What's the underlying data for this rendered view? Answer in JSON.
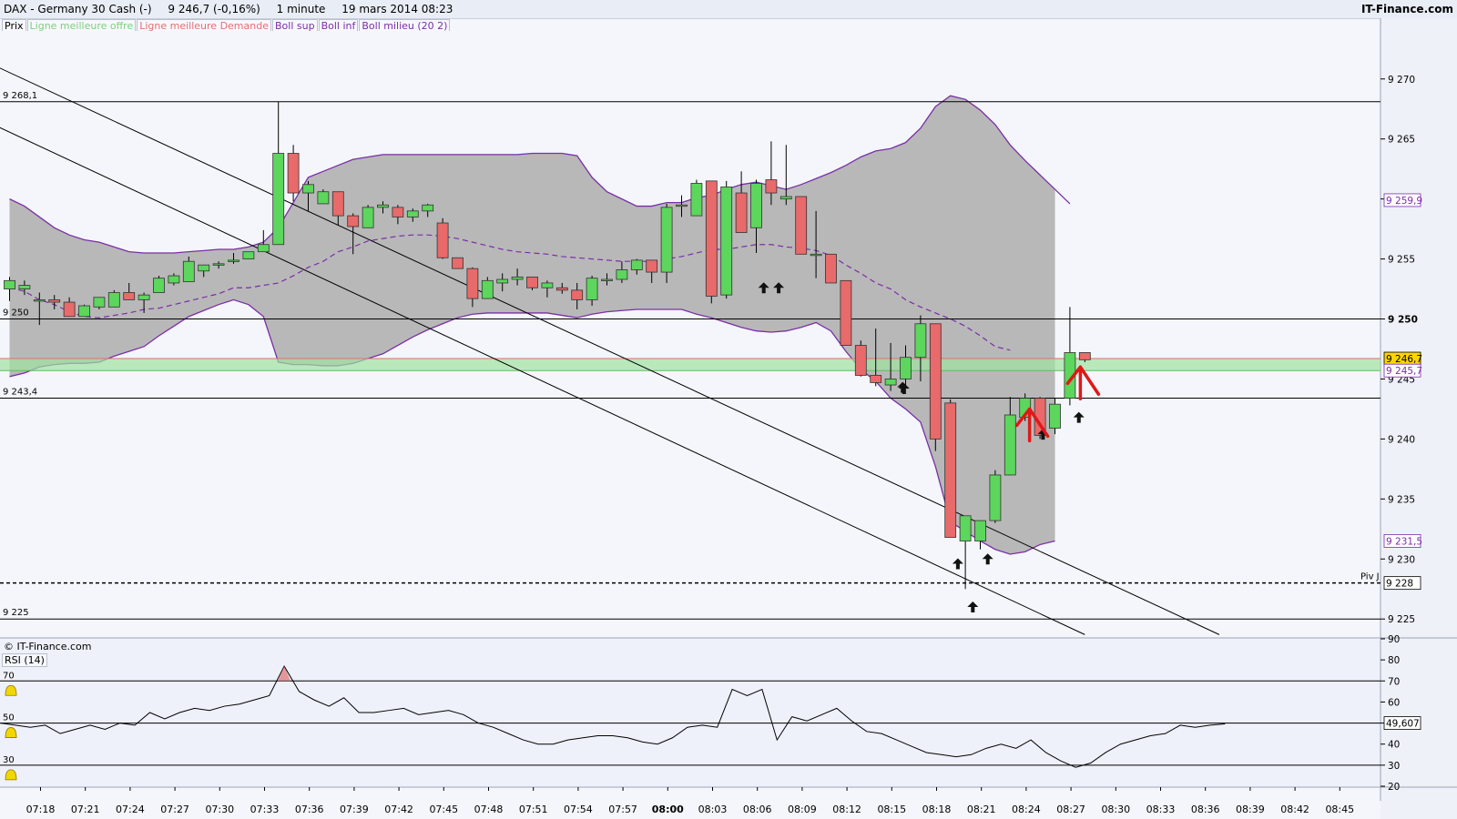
{
  "header": {
    "instrument": "DAX - Germany 30 Cash (-)",
    "last": "9 246,7 (-0,16%)",
    "timeframe": "1 minute",
    "datetime": "19 mars 2014 08:23",
    "site": "IT-Finance.com"
  },
  "legend": [
    {
      "label": "Prix",
      "color": "#000000"
    },
    {
      "label": "Ligne meilleure offre",
      "color": "#7ccf7c"
    },
    {
      "label": "Ligne meilleure Demande",
      "color": "#e07070"
    },
    {
      "label": "Boll sup",
      "color": "#7a2ea8"
    },
    {
      "label": "Boll inf",
      "color": "#7a2ea8"
    },
    {
      "label": "Boll milieu (20 2)",
      "color": "#7a2ea8"
    }
  ],
  "footer": {
    "copyright": "© IT-Finance.com",
    "rsi_label": "RSI (14)"
  },
  "colors": {
    "up": "#5cd65c",
    "down": "#e86a6a",
    "band": "#b4b4b4",
    "boll": "#7a2ea8",
    "bg": "#eef1fa",
    "plot": "#f4f6fb"
  },
  "chart_data": {
    "type": "candlestick",
    "x_start": "07:18",
    "x_tick_labels": [
      "07:18",
      "07:21",
      "07:24",
      "07:27",
      "07:30",
      "07:33",
      "07:36",
      "07:39",
      "07:42",
      "07:45",
      "07:48",
      "07:51",
      "07:54",
      "07:57",
      "08:00",
      "08:03",
      "08:06",
      "08:09",
      "08:12",
      "08:15",
      "08:18",
      "08:21",
      "08:24",
      "08:27",
      "08:30",
      "08:33",
      "08:36",
      "08:39",
      "08:42",
      "08:45"
    ],
    "x_bold_label": "08:00",
    "y_ticks": [
      9225,
      9230,
      9235,
      9240,
      9245,
      9250,
      9255,
      9260,
      9265,
      9270
    ],
    "y_tick_labels": [
      "9 225",
      "9 230",
      "9 235",
      "9 240",
      "9 245",
      "9 250",
      "9 255",
      "9 260",
      "9 265",
      "9 270"
    ],
    "ylim": [
      9223.5,
      9274
    ],
    "candles": [
      [
        9252.5,
        9253.5,
        9251.5,
        9253.2
      ],
      [
        9252.5,
        9253.2,
        9252,
        9252.8
      ],
      [
        9251.5,
        9252.2,
        9249.5,
        9251.6
      ],
      [
        9251.6,
        9252,
        9250.8,
        9251.4
      ],
      [
        9251.4,
        9251.8,
        9250.2,
        9250.2
      ],
      [
        9250.2,
        9251.2,
        9250.2,
        9251.1
      ],
      [
        9251.0,
        9251.8,
        9250.8,
        9251.8
      ],
      [
        9251.0,
        9252.4,
        9251,
        9252.2
      ],
      [
        9252.2,
        9253,
        9251.6,
        9251.6
      ],
      [
        9251.6,
        9252.2,
        9250.5,
        9252.0
      ],
      [
        9252.2,
        9253.6,
        9252.2,
        9253.4
      ],
      [
        9253.0,
        9253.8,
        9252.8,
        9253.6
      ],
      [
        9253.1,
        9255.2,
        9253.1,
        9254.8
      ],
      [
        9254.0,
        9254.5,
        9253.5,
        9254.5
      ],
      [
        9254.5,
        9254.8,
        9254.2,
        9254.6
      ],
      [
        9254.8,
        9255.5,
        9254.6,
        9254.9
      ],
      [
        9255.0,
        9255.6,
        9255,
        9255.6
      ],
      [
        9255.6,
        9257.4,
        9255.6,
        9256.2
      ],
      [
        9256.2,
        9268.1,
        9256.2,
        9263.8
      ],
      [
        9263.8,
        9264.5,
        9259.8,
        9260.5
      ],
      [
        9260.5,
        9261.5,
        9259,
        9261.2
      ],
      [
        9259.6,
        9260.8,
        9259.6,
        9260.6
      ],
      [
        9260.6,
        9260.6,
        9257.8,
        9258.6
      ],
      [
        9258.6,
        9258.8,
        9255.4,
        9257.7
      ],
      [
        9257.6,
        9259.5,
        9257.6,
        9259.3
      ],
      [
        9259.3,
        9259.8,
        9258.8,
        9259.5
      ],
      [
        9259.3,
        9259.5,
        9257.9,
        9258.5
      ],
      [
        9258.5,
        9259.2,
        9258.1,
        9259.0
      ],
      [
        9259.0,
        9259.6,
        9258.5,
        9259.5
      ],
      [
        9258.0,
        9258.4,
        9255,
        9255.1
      ],
      [
        9255.1,
        9255.1,
        9254.2,
        9254.2
      ],
      [
        9254.2,
        9254.3,
        9251.0,
        9251.7
      ],
      [
        9251.7,
        9253.5,
        9251.7,
        9253.2
      ],
      [
        9253.0,
        9253.8,
        9252.3,
        9253.3
      ],
      [
        9253.3,
        9254.2,
        9252.8,
        9253.5
      ],
      [
        9253.5,
        9253.5,
        9252.4,
        9252.6
      ],
      [
        9252.6,
        9253.2,
        9251.8,
        9253.0
      ],
      [
        9252.6,
        9253,
        9252.1,
        9252.4
      ],
      [
        9252.4,
        9253,
        9250.8,
        9251.6
      ],
      [
        9251.6,
        9253.6,
        9251.1,
        9253.4
      ],
      [
        9253.2,
        9253.8,
        9252.8,
        9253.3
      ],
      [
        9253.3,
        9254.8,
        9253,
        9254.1
      ],
      [
        9254.1,
        9255,
        9253.7,
        9254.9
      ],
      [
        9254.9,
        9254.9,
        9253,
        9253.9
      ],
      [
        9253.9,
        9259.6,
        9253.0,
        9259.3
      ],
      [
        9259.4,
        9260.3,
        9258.5,
        9259.5
      ],
      [
        9258.6,
        9261.6,
        9258.6,
        9261.3
      ],
      [
        9261.5,
        9261.5,
        9251.3,
        9251.9
      ],
      [
        9252.0,
        9261.5,
        9251.7,
        9261.0
      ],
      [
        9260.5,
        9262.3,
        9257.2,
        9257.2
      ],
      [
        9257.6,
        9261.6,
        9255.5,
        9261.3
      ],
      [
        9261.6,
        9264.8,
        9259.5,
        9260.5
      ],
      [
        9260.0,
        9264.5,
        9259.5,
        9260.2
      ],
      [
        9260.2,
        9260.2,
        9255.4,
        9255.4
      ],
      [
        9255.3,
        9259,
        9253.4,
        9255.4
      ],
      [
        9255.4,
        9255.4,
        9253.2,
        9253.0
      ],
      [
        9253.2,
        9253.2,
        9248.0,
        9247.8
      ],
      [
        9247.8,
        9248.2,
        9245.2,
        9245.3
      ],
      [
        9245.3,
        9249.2,
        9244.4,
        9244.7
      ],
      [
        9244.5,
        9248.0,
        9244.0,
        9245.0
      ],
      [
        9245.0,
        9247.8,
        9244.5,
        9246.8
      ],
      [
        9246.8,
        9250.3,
        9244.8,
        9249.6
      ],
      [
        9249.6,
        9249.6,
        9239.0,
        9240.0
      ],
      [
        9243.0,
        9243.3,
        9231.8,
        9231.8
      ],
      [
        9231.5,
        9233.2,
        9227.5,
        9233.6
      ],
      [
        9231.5,
        9233.0,
        9230.8,
        9233.2
      ],
      [
        9233.2,
        9237.4,
        9233.0,
        9237.0
      ],
      [
        9237.0,
        9243.5,
        9237.0,
        9242.0
      ],
      [
        9241.8,
        9243.8,
        9241.5,
        9243.4
      ],
      [
        9243.4,
        9243.5,
        9240.0,
        9240.3
      ],
      [
        9240.9,
        9243.4,
        9240.4,
        9242.9
      ],
      [
        9243.4,
        9251.0,
        9242.8,
        9247.2
      ],
      [
        9247.2,
        9247.2,
        9246.4,
        9246.6
      ]
    ],
    "bollinger": {
      "upper": [
        9260.0,
        9259.4,
        9258.5,
        9257.6,
        9257.0,
        9256.6,
        9256.4,
        9256.0,
        9255.6,
        9255.5,
        9255.5,
        9255.5,
        9255.6,
        9255.7,
        9255.8,
        9255.8,
        9256.0,
        9256.4,
        9257.6,
        9259.7,
        9261.8,
        9262.3,
        9262.8,
        9263.3,
        9263.5,
        9263.7,
        9263.7,
        9263.7,
        9263.7,
        9263.7,
        9263.7,
        9263.7,
        9263.7,
        9263.7,
        9263.7,
        9263.8,
        9263.8,
        9263.8,
        9263.6,
        9261.8,
        9260.6,
        9260.0,
        9259.4,
        9259.4,
        9259.7,
        9259.7,
        9260.1,
        9260.3,
        9260.8,
        9261.2,
        9261.4,
        9261.1,
        9260.8,
        9261.2,
        9261.7,
        9262.2,
        9262.8,
        9263.5,
        9264.0,
        9264.2,
        9264.7,
        9265.9,
        9267.7,
        9268.6,
        9268.3,
        9267.4,
        9266.2,
        9264.5,
        9263.2,
        9262.0,
        9260.8,
        9259.6
      ],
      "middle": [
        9252.6,
        9252.3,
        9251.6,
        9251.2,
        9250.6,
        9250.2,
        9250.1,
        9250.3,
        9250.5,
        9250.8,
        9250.9,
        9251.2,
        9251.5,
        9251.8,
        9252.1,
        9252.6,
        9252.6,
        9252.8,
        9253.0,
        9253.6,
        9254.3,
        9254.8,
        9255.6,
        9256.0,
        9256.5,
        9256.7,
        9256.9,
        9257.0,
        9257.0,
        9256.9,
        9256.7,
        9256.4,
        9256.1,
        9255.8,
        9255.6,
        9255.5,
        9255.4,
        9255.2,
        9255.1,
        9255.0,
        9254.9,
        9254.8,
        9254.8,
        9254.8,
        9255.0,
        9255.2,
        9255.5,
        9255.8,
        9255.8,
        9256.0,
        9256.2,
        9256.2,
        9256.0,
        9255.9,
        9255.7,
        9255.3,
        9254.5,
        9253.8,
        9253.0,
        9252.5,
        9251.6,
        9251.0,
        9250.5,
        9250.0,
        9249.4,
        9248.6,
        9247.7,
        9247.4
      ],
      "lower": [
        9245.2,
        9245.5,
        9246.0,
        9246.2,
        9246.3,
        9246.3,
        9246.4,
        9246.9,
        9247.3,
        9247.7,
        9248.6,
        9249.4,
        9250.2,
        9250.7,
        9251.2,
        9251.6,
        9251.2,
        9250.2,
        9246.4,
        9246.2,
        9246.2,
        9246.1,
        9246.1,
        9246.3,
        9246.7,
        9247.1,
        9247.8,
        9248.5,
        9249.1,
        9249.6,
        9250.1,
        9250.4,
        9250.5,
        9250.5,
        9250.5,
        9250.5,
        9250.5,
        9250.3,
        9250.1,
        9250.4,
        9250.6,
        9250.7,
        9250.8,
        9250.8,
        9250.8,
        9250.8,
        9250.4,
        9250.1,
        9249.7,
        9249.3,
        9249.0,
        9248.9,
        9249.0,
        9249.3,
        9249.7,
        9249.0,
        9247.3,
        9245.8,
        9244.8,
        9243.4,
        9242.5,
        9241.4,
        9237.7,
        9233.1,
        9232.3,
        9231.5,
        9230.8,
        9230.4,
        9230.6,
        9231.2,
        9231.5
      ],
      "upper_ends_at_index": 71,
      "middle_ends_at_index": 67
    },
    "hlines": [
      {
        "value": 9268.1,
        "label": "9 268,1",
        "style": "solid"
      },
      {
        "value": 9250,
        "label": "9 250",
        "style": "solid",
        "axis_bold": "9 250"
      },
      {
        "value": 9243.4,
        "label": "9 243,4",
        "style": "solid"
      },
      {
        "value": 9225,
        "label": "9 225",
        "style": "solid"
      },
      {
        "value": 9228,
        "label": "Piv J",
        "style": "dashed",
        "axis_tag": "9 228"
      }
    ],
    "bid_ask_band": {
      "bid": 9245.7,
      "ask": 9246.7
    },
    "axis_tags": [
      {
        "value": 9259.9,
        "text": "9 259,9",
        "color": "#7a2ea8"
      },
      {
        "value": 9246.7,
        "text": "9 246,7",
        "color": "#000000",
        "fill": "#ffd400"
      },
      {
        "value": 9245.7,
        "text": "9 245,7",
        "color": "#7a2ea8"
      },
      {
        "value": 9231.5,
        "text": "9 231,5",
        "color": "#7a2ea8"
      },
      {
        "value": 9228,
        "text": "9 228",
        "color": "#000000"
      }
    ],
    "trendlines": [
      {
        "x1": -14.5,
        "y1": 9274,
        "x2": 72.0,
        "y2": 9223.7
      },
      {
        "x1": -6.0,
        "y1": 9274,
        "x2": 81.0,
        "y2": 9223.7
      }
    ],
    "arrows_up": [
      [
        50.5,
        9252.6
      ],
      [
        51.5,
        9252.6
      ],
      [
        59.8,
        9244.3
      ],
      [
        59.9,
        9244.2
      ],
      [
        63.5,
        9229.6
      ],
      [
        64.5,
        9226.0
      ],
      [
        65.5,
        9230.0
      ],
      [
        69.2,
        9240.4
      ],
      [
        71.6,
        9241.8
      ]
    ],
    "red_marks": [
      {
        "x": 68.3,
        "y": 9242.5
      },
      {
        "x": 71.7,
        "y": 9246.0
      }
    ],
    "rsi": {
      "label": "RSI (14)",
      "ylim": [
        20,
        90
      ],
      "y_ticks": [
        20,
        30,
        40,
        50,
        60,
        70,
        80,
        90
      ],
      "levels": [
        70,
        50,
        30
      ],
      "level_labels": [
        "70",
        "50",
        "30"
      ],
      "last_value": "49,607",
      "values": [
        50,
        49,
        48,
        49,
        45,
        47,
        49,
        47,
        50,
        49,
        55,
        52,
        55,
        57,
        56,
        58,
        59,
        61,
        63,
        77,
        65,
        61,
        58,
        62,
        55,
        55,
        56,
        57,
        54,
        55,
        56,
        54,
        50,
        48,
        45,
        42,
        40,
        40,
        42,
        43,
        44,
        44,
        43,
        41,
        40,
        43,
        48,
        49,
        48,
        66,
        63,
        66,
        42,
        53,
        51,
        54,
        57,
        51,
        46,
        45,
        42,
        39,
        36,
        35,
        34,
        35,
        38,
        40,
        38,
        42,
        36,
        32,
        29,
        31,
        36,
        40,
        42,
        44,
        45,
        49,
        48,
        49,
        49.6
      ],
      "overbought_marker_index": 19
    }
  }
}
